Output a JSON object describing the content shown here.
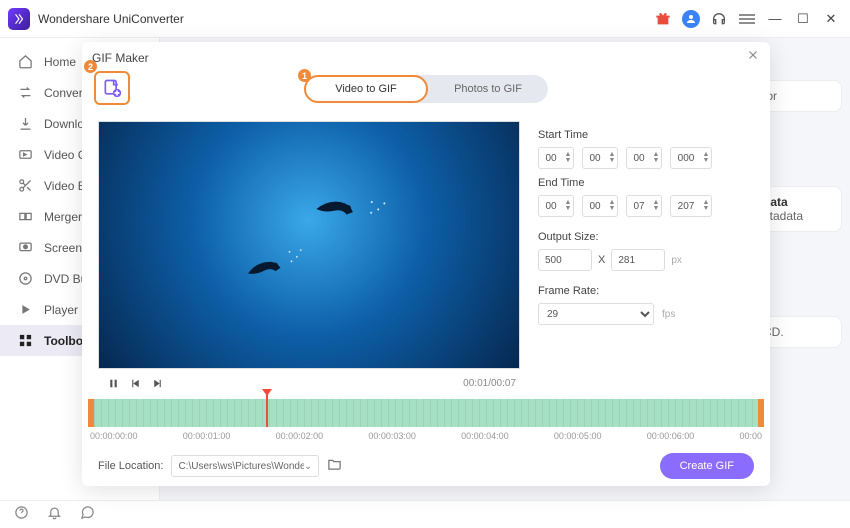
{
  "app": {
    "title": "Wondershare UniConverter"
  },
  "sidebar": {
    "items": [
      {
        "label": "Home"
      },
      {
        "label": "Converter"
      },
      {
        "label": "Downloader"
      },
      {
        "label": "Video Compressor"
      },
      {
        "label": "Video Editor"
      },
      {
        "label": "Merger"
      },
      {
        "label": "Screen Recorder"
      },
      {
        "label": "DVD Burner"
      },
      {
        "label": "Player"
      },
      {
        "label": "Toolbox"
      }
    ]
  },
  "bgFragments": {
    "one": "tor",
    "twoTitle": "data",
    "twoBody": "etadata",
    "three": "CD."
  },
  "modal": {
    "title": "GIF Maker",
    "tabs": {
      "video": "Video to GIF",
      "photos": "Photos to GIF"
    },
    "badges": {
      "one": "1",
      "two": "2"
    },
    "timecode": "00:01/00:07",
    "startTimeLabel": "Start Time",
    "endTimeLabel": "End Time",
    "start": {
      "h": "00",
      "m": "00",
      "s": "00",
      "ms": "000"
    },
    "end": {
      "h": "00",
      "m": "00",
      "s": "07",
      "ms": "207"
    },
    "outputSizeLabel": "Output Size:",
    "size": {
      "w": "500",
      "h": "281",
      "sep": "X",
      "unit": "px"
    },
    "frameRateLabel": "Frame Rate:",
    "fps": {
      "value": "29",
      "unit": "fps"
    },
    "timeLabels": [
      "00:00:00:00",
      "00:00:01:00",
      "00:00:02:00",
      "00:00:03:00",
      "00:00:04:00",
      "00:00:05:00",
      "00:00:06:00",
      "00:00"
    ],
    "fileLocationLabel": "File Location:",
    "fileLocationPath": "C:\\Users\\ws\\Pictures\\Wonders",
    "createBtn": "Create GIF"
  }
}
